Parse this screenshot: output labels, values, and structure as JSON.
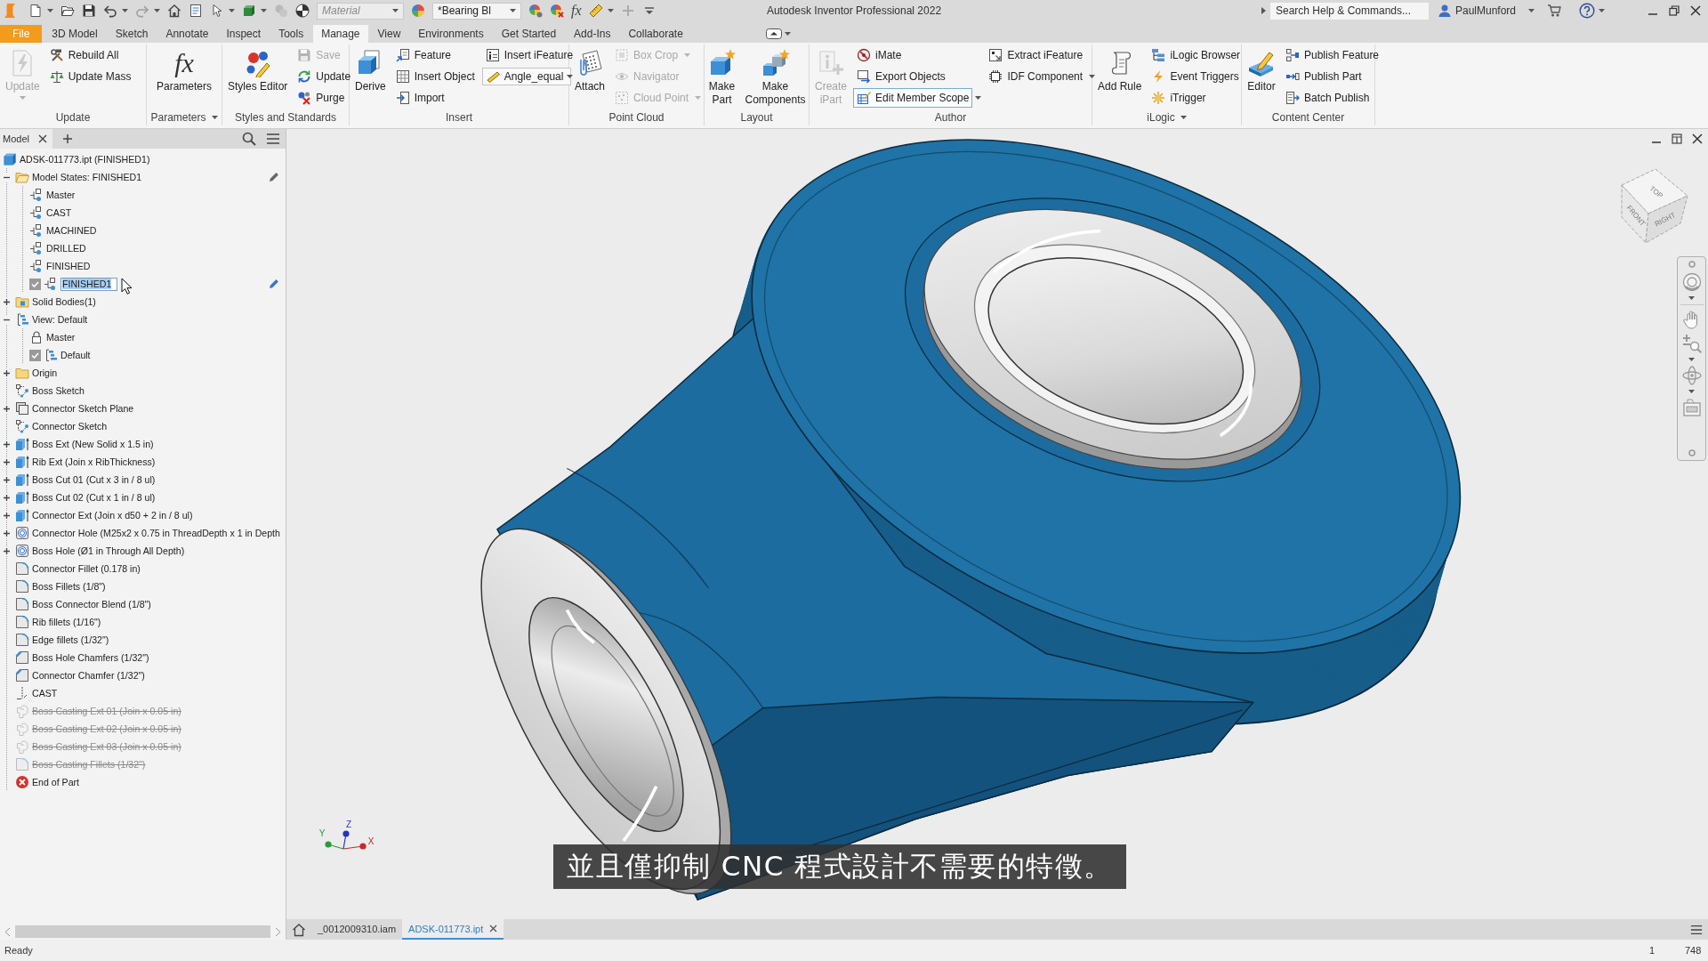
{
  "title_bar": {
    "quick_access": [
      {
        "kind": "button",
        "disabled": false,
        "dropdown": true
      },
      {
        "kind": "button",
        "disabled": false,
        "dropdown": false
      },
      {
        "kind": "button",
        "disabled": false,
        "dropdown": false
      },
      {
        "kind": "button",
        "disabled": false,
        "dropdown": true
      },
      {
        "kind": "button",
        "disabled": true,
        "dropdown": true
      },
      {
        "kind": "button",
        "disabled": false,
        "dropdown": false
      },
      {
        "kind": "button",
        "disabled": false,
        "dropdown": false
      },
      {
        "kind": "button",
        "disabled": false,
        "dropdown": true
      },
      {
        "kind": "button",
        "disabled": false,
        "dropdown": true
      },
      {
        "kind": "button",
        "disabled": true,
        "dropdown": false
      },
      {
        "kind": "button",
        "disabled": false,
        "dropdown": false
      },
      {
        "kind": "combo",
        "placeholder": "Material"
      },
      {
        "kind": "button",
        "disabled": false,
        "dropdown": false
      },
      {
        "kind": "combo",
        "value": "*Bearing Bl"
      },
      {
        "kind": "button",
        "disabled": false,
        "dropdown": false
      },
      {
        "kind": "button",
        "disabled": false,
        "dropdown": false
      },
      {
        "kind": "button",
        "glyph": "fx",
        "disabled": false,
        "dropdown": false
      },
      {
        "kind": "button",
        "disabled": false,
        "dropdown": true
      },
      {
        "kind": "button",
        "disabled": true,
        "dropdown": false
      },
      {
        "kind": "button",
        "disabled": false,
        "dropdown": false
      }
    ],
    "title": "Autodesk Inventor Professional 2022",
    "search": {
      "placeholder": "Search Help & Commands..."
    },
    "user": "PaulMunford"
  },
  "ribbon_tabs": [
    {
      "label": "File",
      "kind": "file",
      "selected": false
    },
    {
      "label": "3D Model",
      "kind": "tab",
      "selected": false
    },
    {
      "label": "Sketch",
      "kind": "tab",
      "selected": false
    },
    {
      "label": "Annotate",
      "kind": "tab",
      "selected": false
    },
    {
      "label": "Inspect",
      "kind": "tab",
      "selected": false
    },
    {
      "label": "Tools",
      "kind": "tab",
      "selected": false
    },
    {
      "label": "Manage",
      "kind": "tab",
      "selected": true
    },
    {
      "label": "View",
      "kind": "tab",
      "selected": false
    },
    {
      "label": "Environments",
      "kind": "tab",
      "selected": false
    },
    {
      "label": "Get Started",
      "kind": "tab",
      "selected": false
    },
    {
      "label": "Add-Ins",
      "kind": "tab",
      "selected": false
    },
    {
      "label": "Collaborate",
      "kind": "tab",
      "selected": false
    }
  ],
  "ribbon_panels": [
    {
      "label": "Update",
      "dropdown": false,
      "tools": [
        {
          "label": "Update",
          "kind": "large",
          "disabled": true,
          "dropdown": true,
          "highlighted": false
        },
        {
          "label": "Rebuild All",
          "kind": "small",
          "disabled": false,
          "dropdown": false,
          "highlighted": false
        },
        {
          "label": "Update Mass",
          "kind": "small",
          "disabled": false,
          "dropdown": false,
          "highlighted": false
        }
      ]
    },
    {
      "label": "Parameters",
      "dropdown": true,
      "tools": [
        {
          "label": "Parameters",
          "kind": "large",
          "glyph": "fx",
          "disabled": false,
          "dropdown": false,
          "highlighted": false
        }
      ]
    },
    {
      "label": "Styles and Standards",
      "dropdown": false,
      "tools": [
        {
          "label": "Styles Editor",
          "kind": "large",
          "disabled": false,
          "dropdown": false,
          "highlighted": false
        },
        {
          "label": "Save",
          "kind": "small",
          "disabled": true,
          "dropdown": false,
          "highlighted": false
        },
        {
          "label": "Update",
          "kind": "small",
          "disabled": false,
          "dropdown": false,
          "highlighted": false
        },
        {
          "label": "Purge",
          "kind": "small",
          "disabled": false,
          "dropdown": false,
          "highlighted": false
        }
      ]
    },
    {
      "label": "Insert",
      "dropdown": false,
      "tools": [
        {
          "label": "Derive",
          "kind": "large",
          "disabled": false,
          "dropdown": false,
          "highlighted": false
        },
        {
          "label": "Feature",
          "kind": "small",
          "disabled": false,
          "dropdown": false,
          "highlighted": false
        },
        {
          "label": "Insert Object",
          "kind": "small",
          "disabled": false,
          "dropdown": false,
          "highlighted": false
        },
        {
          "label": "Import",
          "kind": "small",
          "disabled": false,
          "dropdown": false,
          "highlighted": false
        },
        {
          "label": "Insert iFeature",
          "kind": "small",
          "disabled": false,
          "dropdown": false,
          "highlighted": false
        },
        {
          "value": "Angle_equal",
          "kind": "combo",
          "disabled": false,
          "dropdown": true,
          "highlighted": false
        }
      ]
    },
    {
      "label": "Point Cloud",
      "dropdown": false,
      "tools": [
        {
          "label": "Attach",
          "kind": "large",
          "disabled": false,
          "dropdown": false,
          "highlighted": false
        },
        {
          "label": "Box Crop",
          "kind": "small",
          "disabled": true,
          "dropdown": true,
          "highlighted": false
        },
        {
          "label": "Navigator",
          "kind": "small",
          "disabled": true,
          "dropdown": false,
          "highlighted": false
        },
        {
          "label": "Cloud Point",
          "kind": "small",
          "disabled": true,
          "dropdown": true,
          "highlighted": false
        }
      ]
    },
    {
      "label": "Layout",
      "dropdown": false,
      "tools": [
        {
          "label": "Make\nPart",
          "kind": "large",
          "disabled": false,
          "dropdown": false,
          "highlighted": false
        },
        {
          "label": "Make\nComponents",
          "kind": "large",
          "disabled": false,
          "dropdown": false,
          "highlighted": false
        }
      ]
    },
    {
      "label": "Author",
      "dropdown": false,
      "tools": [
        {
          "label": "Create\niPart",
          "kind": "large",
          "disabled": true,
          "dropdown": false,
          "highlighted": false
        },
        {
          "label": "iMate",
          "kind": "small",
          "disabled": false,
          "dropdown": false,
          "highlighted": false
        },
        {
          "label": "Export Objects",
          "kind": "small",
          "disabled": false,
          "dropdown": false,
          "highlighted": false
        },
        {
          "label": "Edit Member Scope",
          "kind": "small",
          "disabled": false,
          "dropdown": true,
          "highlighted": true
        },
        {
          "label": "Extract iFeature",
          "kind": "small",
          "disabled": false,
          "dropdown": false,
          "highlighted": false
        },
        {
          "label": "IDF Component",
          "kind": "small",
          "disabled": false,
          "dropdown": true,
          "highlighted": false
        }
      ]
    },
    {
      "label": "iLogic",
      "dropdown": true,
      "tools": [
        {
          "label": "Add Rule",
          "kind": "large",
          "disabled": false,
          "dropdown": false,
          "highlighted": false
        },
        {
          "label": "iLogic Browser",
          "kind": "small",
          "disabled": false,
          "dropdown": false,
          "highlighted": false
        },
        {
          "label": "Event Triggers",
          "kind": "small",
          "disabled": false,
          "dropdown": false,
          "highlighted": false
        },
        {
          "label": "iTrigger",
          "kind": "small",
          "disabled": false,
          "dropdown": false,
          "highlighted": false
        }
      ]
    },
    {
      "label": "Content Center",
      "dropdown": false,
      "tools": [
        {
          "label": "Editor",
          "kind": "large",
          "disabled": false,
          "dropdown": false,
          "highlighted": false
        },
        {
          "label": "Publish Feature",
          "kind": "small",
          "disabled": false,
          "dropdown": false,
          "highlighted": false
        },
        {
          "label": "Publish Part",
          "kind": "small",
          "disabled": false,
          "dropdown": false,
          "highlighted": false
        },
        {
          "label": "Batch Publish",
          "kind": "small",
          "disabled": false,
          "dropdown": false,
          "highlighted": false
        }
      ]
    }
  ],
  "browser": {
    "tab": "Model",
    "tree": {
      "label": "ADSK-011773.ipt (FINISHED1)",
      "kind": "part",
      "suppressed": false,
      "children": [
        {
          "label": "Model States: FINISHED1",
          "kind": "folder-open",
          "expanded": true,
          "edit_icon": true,
          "suppressed": false,
          "children": [
            {
              "label": "Master",
              "kind": "model-state",
              "suppressed": false
            },
            {
              "label": "CAST",
              "kind": "model-state",
              "suppressed": false
            },
            {
              "label": "MACHINED",
              "kind": "model-state",
              "suppressed": false
            },
            {
              "label": "DRILLED",
              "kind": "model-state",
              "suppressed": false
            },
            {
              "label": "FINISHED",
              "kind": "model-state",
              "suppressed": false
            },
            {
              "label": "FINISHED1",
              "kind": "model-state",
              "checked": true,
              "editing": true,
              "edit_icon": true,
              "suppressed": false
            }
          ]
        },
        {
          "label": "Solid Bodies(1)",
          "kind": "bodies-folder",
          "expanded": false,
          "suppressed": false
        },
        {
          "label": "View: Default",
          "kind": "view",
          "expanded": true,
          "suppressed": false,
          "children": [
            {
              "label": "Master",
              "kind": "lock",
              "suppressed": false
            },
            {
              "label": "Default",
              "kind": "view",
              "checked": true,
              "suppressed": false
            }
          ]
        },
        {
          "label": "Origin",
          "kind": "folder",
          "expanded": false,
          "suppressed": false
        },
        {
          "label": "Boss Sketch",
          "kind": "sketch",
          "suppressed": false
        },
        {
          "label": "Connector Sketch Plane",
          "kind": "plane",
          "expanded": false,
          "suppressed": false
        },
        {
          "label": "Connector Sketch",
          "kind": "sketch",
          "suppressed": false
        },
        {
          "label": "Boss Ext (New Solid x 1.5 in)",
          "kind": "extrude",
          "expanded": false,
          "suppressed": false
        },
        {
          "label": "Rib Ext (Join x RibThickness)",
          "kind": "extrude",
          "expanded": false,
          "suppressed": false
        },
        {
          "label": "Boss Cut 01 (Cut x 3 in / 8 ul)",
          "kind": "extrude",
          "expanded": false,
          "suppressed": false
        },
        {
          "label": "Boss Cut 02 (Cut x 1 in / 8 ul)",
          "kind": "extrude",
          "expanded": false,
          "suppressed": false
        },
        {
          "label": "Connector Ext (Join x d50 + 2 in / 8 ul)",
          "kind": "extrude",
          "expanded": false,
          "suppressed": false
        },
        {
          "label": "Connector Hole (M25x2 x 0.75 in ThreadDepth x 1 in Depth",
          "kind": "hole",
          "expanded": false,
          "suppressed": false
        },
        {
          "label": "Boss Hole (Ø1 in Through All Depth)",
          "kind": "hole",
          "expanded": false,
          "suppressed": false
        },
        {
          "label": "Connector Fillet (0.178 in)",
          "kind": "fillet",
          "suppressed": false
        },
        {
          "label": "Boss Fillets (1/8\")",
          "kind": "fillet",
          "suppressed": false
        },
        {
          "label": "Boss Connector Blend (1/8\")",
          "kind": "fillet",
          "suppressed": false
        },
        {
          "label": "Rib fillets (1/16\")",
          "kind": "fillet",
          "suppressed": false
        },
        {
          "label": "Edge fillets (1/32\")",
          "kind": "fillet",
          "suppressed": false
        },
        {
          "label": "Boss Hole Chamfers (1/32\")",
          "kind": "chamfer",
          "suppressed": false
        },
        {
          "label": "Connector Chamfer (1/32\")",
          "kind": "chamfer",
          "suppressed": false
        },
        {
          "label": "CAST",
          "kind": "marker",
          "suppressed": false
        },
        {
          "label": "Boss Casting Ext 01 (Join x 0.05 in)",
          "kind": "emboss",
          "suppressed": true
        },
        {
          "label": "Boss Casting Ext 02 (Join x 0.05 in)",
          "kind": "emboss",
          "suppressed": true
        },
        {
          "label": "Boss Casting Ext 03 (Join x 0.05 in)",
          "kind": "emboss",
          "suppressed": true
        },
        {
          "label": "Boss Casting Fillets (1/32\")",
          "kind": "fillet",
          "suppressed": true
        },
        {
          "label": "End of Part",
          "kind": "end",
          "suppressed": false
        }
      ]
    }
  },
  "viewport": {
    "view_cube": [
      "TOP",
      "FRONT",
      "RIGHT"
    ],
    "triad": [
      {
        "label": "Y",
        "color": "#2a9a3a"
      },
      {
        "label": "Z",
        "color": "#2536b8"
      },
      {
        "label": "X",
        "color": "#c8282c"
      }
    ],
    "subtitle": "並且僅抑制 CNC 程式設計不需要的特徵。"
  },
  "document_tabs": [
    {
      "label": "_0012009310.iam",
      "selected": false
    },
    {
      "label": "ADSK-011773.ipt",
      "selected": true
    }
  ],
  "status_bar": {
    "message": "Ready",
    "fields": [
      "1",
      "748"
    ]
  }
}
